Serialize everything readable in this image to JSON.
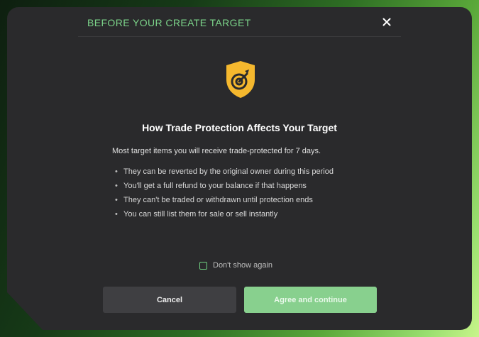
{
  "modal": {
    "title": "BEFORE YOUR CREATE TARGET",
    "close_icon": "close-icon",
    "shield_icon": "shield-target-icon",
    "heading": "How Trade Protection Affects Your Target",
    "intro": "Most target items you will receive trade-protected for 7 days.",
    "bullets": [
      "They can be reverted by the original owner during this period",
      "You'll get a full refund to your balance if that happens",
      "They can't be traded or withdrawn until protection ends",
      "You can still list them for sale or sell instantly"
    ],
    "checkbox_label": "Don't show again",
    "checkbox_checked": false,
    "cancel_label": "Cancel",
    "agree_label": "Agree and continue"
  },
  "colors": {
    "accent": "#7cd48a",
    "shield": "#f5b82e",
    "modal_bg": "#2a2a2c",
    "agree_button": "#88d08e"
  }
}
